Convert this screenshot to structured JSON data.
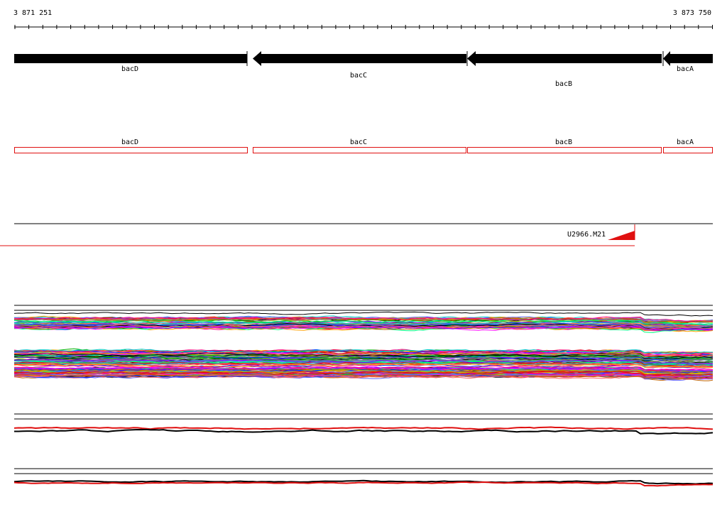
{
  "ruler": {
    "start_label": "3 871 251",
    "end_label": "3 873 750"
  },
  "genes": [
    {
      "name": "bacD"
    },
    {
      "name": "bacC"
    },
    {
      "name": "bacB"
    },
    {
      "name": "bacA"
    }
  ],
  "probe": {
    "label": "U2966.M21"
  },
  "colors": {
    "gene_arrow": "#000000",
    "gene_box": "#e01010",
    "probe": "#e01010",
    "track_line": "#000000"
  }
}
